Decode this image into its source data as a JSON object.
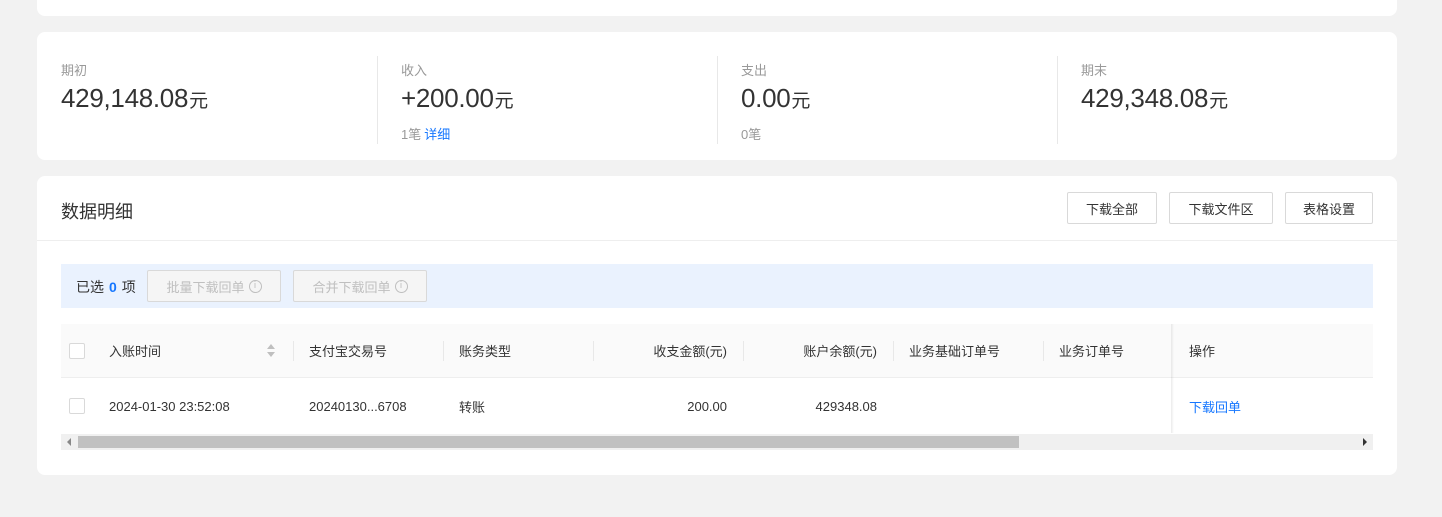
{
  "summary": {
    "opening": {
      "label": "期初",
      "value": "429,148.08",
      "unit": "元"
    },
    "income": {
      "label": "收入",
      "value": "+200.00",
      "unit": "元",
      "count": "1笔",
      "detail_link": "详细"
    },
    "expense": {
      "label": "支出",
      "value": "0.00",
      "unit": "元",
      "count": "0笔"
    },
    "closing": {
      "label": "期末",
      "value": "429,348.08",
      "unit": "元"
    }
  },
  "detail": {
    "title": "数据明细",
    "buttons": {
      "download_all": "下载全部",
      "download_area": "下载文件区",
      "table_settings": "表格设置"
    },
    "selection": {
      "prefix": "已选",
      "count": "0",
      "suffix": "项",
      "batch_download": "批量下载回单",
      "merge_download": "合并下载回单",
      "info_icon": "i"
    },
    "table": {
      "columns": [
        "入账时间",
        "支付宝交易号",
        "账务类型",
        "收支金额(元)",
        "账户余额(元)",
        "业务基础订单号",
        "业务订单号",
        "操作"
      ],
      "rows": [
        {
          "time": "2024-01-30 23:52:08",
          "trade_no": "20240130...6708",
          "type": "转账",
          "amount": "200.00",
          "balance": "429348.08",
          "base_order": "",
          "order": "",
          "action": "下载回单"
        }
      ]
    },
    "scroll_position": 0
  }
}
